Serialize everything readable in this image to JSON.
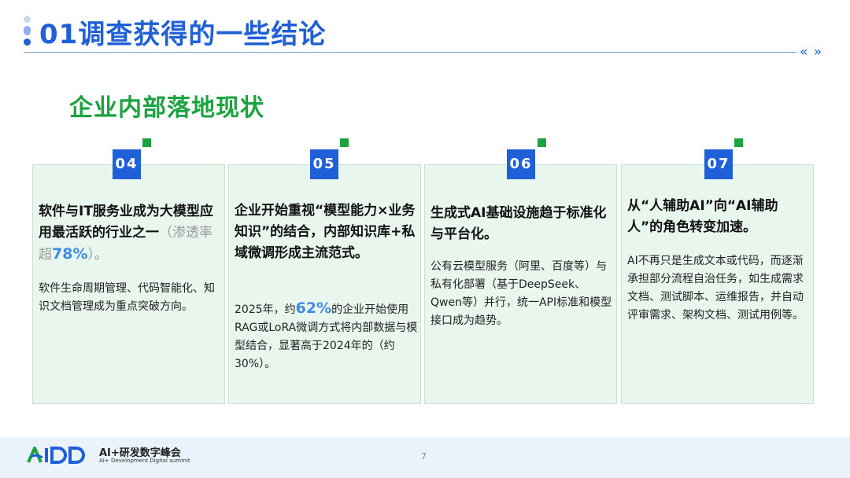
{
  "header": {
    "title": "01调查获得的一些结论",
    "nav_arrows": "« »"
  },
  "section": {
    "title": "企业内部落地现状"
  },
  "cards": [
    {
      "number": "04",
      "head_pre": "软件与IT服务业成为大模型应用最活跃的行业之一",
      "head_muted_open": "（渗透率超",
      "head_highlight": "78%",
      "head_muted_close": "）。",
      "body": "软件生命周期管理、代码智能化、知识文档管理成为重点突破方向。"
    },
    {
      "number": "05",
      "head": "企业开始重视“模型能力×业务知识”的结合，内部知识库+私域微调形成主流范式。",
      "body_pre": "2025年，约",
      "body_highlight": "62%",
      "body_post": "的企业开始使用RAG或LoRA微调方式将内部数据与模型结合，显著高于2024年的（约30%）。"
    },
    {
      "number": "06",
      "head": "生成式AI基础设施趋于标准化与平台化。",
      "body": "公有云模型服务（阿里、百度等）与私有化部署（基于DeepSeek、Qwen等）并行，统一API标准和模型接口成为趋势。"
    },
    {
      "number": "07",
      "head": "从“人辅助AI”向“AI辅助人”的角色转变加速。",
      "body": "AI不再只是生成文本或代码，而逐渐承担部分流程自治任务，如生成需求文档、测试脚本、运维报告，并自动评审需求、架构文档、测试用例等。"
    }
  ],
  "footer": {
    "logo_text": "AiDD",
    "brand_name": "AI+研发数字峰会",
    "brand_sub": "AI+ Development Digital summit",
    "page_number": "7"
  },
  "colors": {
    "primary_blue": "#1f5fd8",
    "green": "#1aa33f",
    "card_bg": "#e9f6ed",
    "highlight_blue": "#3f8bea"
  }
}
